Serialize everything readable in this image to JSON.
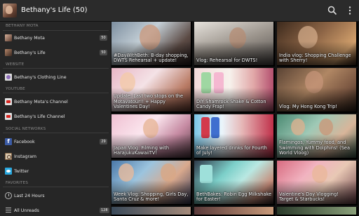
{
  "app": {
    "title": "Bethany's Life (50)",
    "icons": {
      "search": "search-icon",
      "overflow": "overflow-menu-icon"
    }
  },
  "drawer": {
    "sections": [
      {
        "header": "BETHANY MOTA",
        "items": [
          {
            "label": "Bethany Mota",
            "badge": "50",
            "icon": "person-avatar-icon"
          },
          {
            "label": "Bethany's Life",
            "badge": "50",
            "icon": "person-avatar-icon"
          }
        ]
      },
      {
        "header": "WEBSITE",
        "items": [
          {
            "label": "Bethany's Clothing Line",
            "badge": "",
            "icon": "website-icon"
          }
        ]
      },
      {
        "header": "YOUTUBE",
        "items": [
          {
            "label": "Bethany Mota's Channel",
            "badge": "",
            "icon": "youtube-icon"
          },
          {
            "label": "Bethany's Life Channel",
            "badge": "",
            "icon": "youtube-icon"
          }
        ]
      },
      {
        "header": "SOCIAL NETWORKS",
        "items": [
          {
            "label": "Facebook",
            "badge": "29",
            "icon": "facebook-icon"
          },
          {
            "label": "Instagram",
            "badge": "",
            "icon": "instagram-icon"
          },
          {
            "label": "Twitter",
            "badge": "",
            "icon": "twitter-icon"
          }
        ]
      },
      {
        "header": "FAVORITES",
        "items": [
          {
            "label": "Last 24 Hours",
            "badge": "",
            "icon": "clock-icon"
          },
          {
            "label": "All Unreads",
            "badge": "128",
            "icon": "list-icon"
          }
        ]
      }
    ]
  },
  "videos": [
    {
      "title": "#DayWithBeth: B-day shopping, DWTS Rehearsal + update!"
    },
    {
      "title": "Vlog: Rehearsal for DWTS!"
    },
    {
      "title": "India vlog: Shopping Challenge with Sherry!"
    },
    {
      "title": "Update: Last two stops on the Motavatour!! + Happy Valentines Day!"
    },
    {
      "title": "DIY Shamrock Shake & Cotton Candy Frap!"
    },
    {
      "title": "Vlog: My Hong Kong Trip!"
    },
    {
      "title": "Japan Vlog: Filming with HarajukuKawaiiTV!"
    },
    {
      "title": "Make layered drinks for Fourth of July!"
    },
    {
      "title": "Flamingos, Yummy food, and Swimming with Dolphins! (Sea World Vloog)"
    },
    {
      "title": "Week Vlog: Shopping, Girls Day, Santa Cruz & more!"
    },
    {
      "title": "BethBakes: Robin Egg Milkshake for Easter!"
    },
    {
      "title": "Valentine's Day Vlogging! Target & Starbucks!"
    }
  ],
  "colors": {
    "actionbar": "#2b2b2b",
    "drawer": "#262626",
    "section_header": "#8a8a8a",
    "badge": "#4a4a4a"
  }
}
